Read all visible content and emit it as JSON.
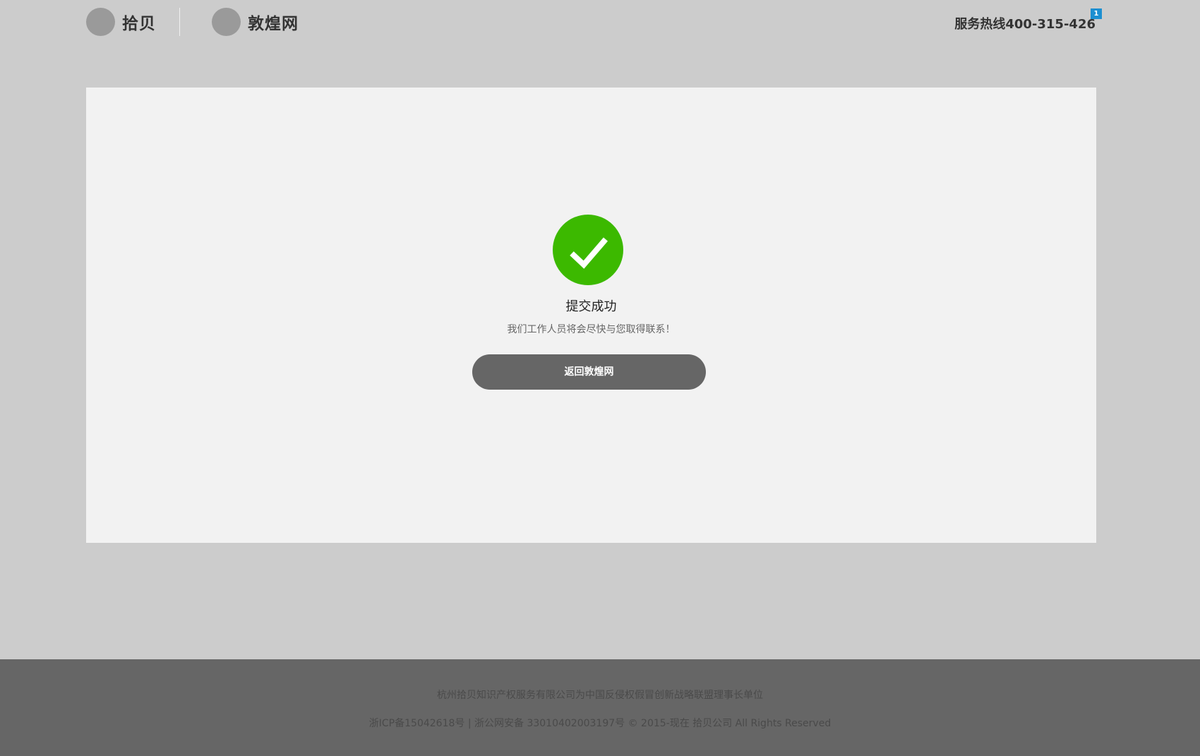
{
  "header": {
    "brands": [
      {
        "name": "拾贝"
      },
      {
        "name": "敦煌网"
      }
    ],
    "hotline": "服务热线400-315-426",
    "badge": "1"
  },
  "result": {
    "title": "提交成功",
    "message": "我们工作人员将会尽快与您取得联系！",
    "back_button_label": "返回敦煌网",
    "icon": "checkmark-circle-icon",
    "icon_color": "#3cb900"
  },
  "footer": {
    "line1": "杭州拾贝知识产权服务有限公司为中国反侵权假冒创新战略联盟理事长单位",
    "line2": "浙ICP备15042618号 | 浙公网安备 33010402003197号 © 2015-现在 拾贝公司 All Rights Reserved"
  },
  "colors": {
    "page_background": "#cccccc",
    "card_background": "#f2f2f2",
    "button_background": "#666666",
    "footer_background": "#666666",
    "badge_background": "#1c8fd1"
  }
}
